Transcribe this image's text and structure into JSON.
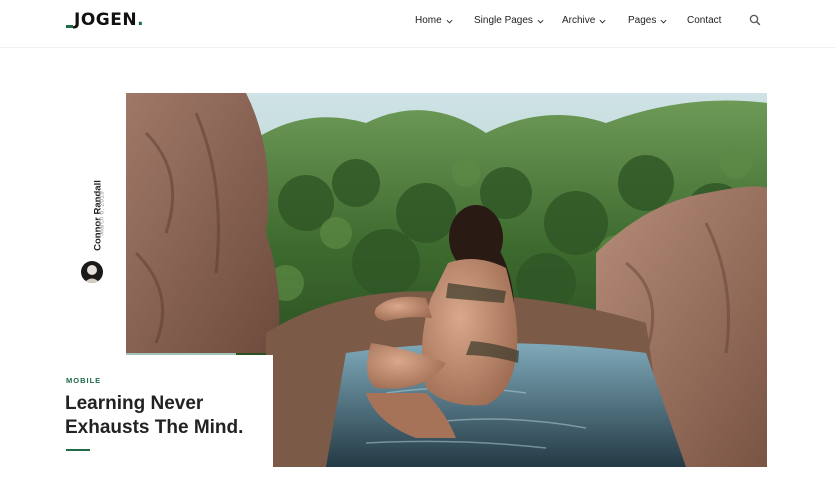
{
  "header": {
    "logo_text": "JOGEN",
    "logo_dot": ".",
    "nav": [
      {
        "label": "Home",
        "has_dropdown": true
      },
      {
        "label": "Single Pages",
        "has_dropdown": true
      },
      {
        "label": "Archive",
        "has_dropdown": true
      },
      {
        "label": "Pages",
        "has_dropdown": true
      },
      {
        "label": "Contact",
        "has_dropdown": false
      }
    ],
    "search_icon": "search-icon"
  },
  "post": {
    "author": "Connor Randall",
    "date": "March 6, 2019",
    "category": "MOBILE",
    "title": "Learning Never Exhausts The Mind."
  },
  "theme": {
    "accent": "#1f6b48",
    "text": "#222222",
    "muted": "#999999"
  }
}
